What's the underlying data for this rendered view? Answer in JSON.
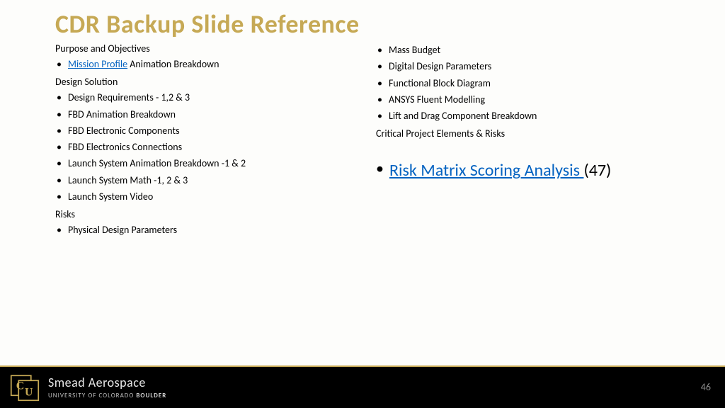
{
  "title": "CDR Backup Slide Reference",
  "col1": {
    "h1": "Purpose and Objectives",
    "l1_link": "Mission Profile",
    "l1_rest": " Animation Breakdown",
    "h2": "Design Solution",
    "l2a": "Design Requirements - 1,2 & 3",
    "l2b": "FBD Animation Breakdown",
    "l2c": "FBD Electronic Components",
    "l2d": "FBD Electronics Connections",
    "l2e": "Launch System Animation Breakdown -1 & 2",
    "l2f": "Launch System Math -1, 2 & 3",
    "l2g": "Launch System Video",
    "h3": "Risks",
    "l3a": "Physical Design Parameters"
  },
  "col2": {
    "l1a": "Mass Budget",
    "l1b": "Digital Design Parameters",
    "l1c": "Functional Block Diagram",
    "l1d": "ANSYS Fluent Modelling",
    "l1e": "Lift and Drag Component Breakdown",
    "h1": "Critical Project Elements & Risks",
    "big_link": "Risk Matrix Scoring Analysis ",
    "big_rest": "(47)"
  },
  "footer": {
    "brand_top": "Smead Aerospace",
    "brand_bottom_pre": "UNIVERSITY OF COLORADO ",
    "brand_bottom_b": "BOULDER",
    "page": "46"
  }
}
